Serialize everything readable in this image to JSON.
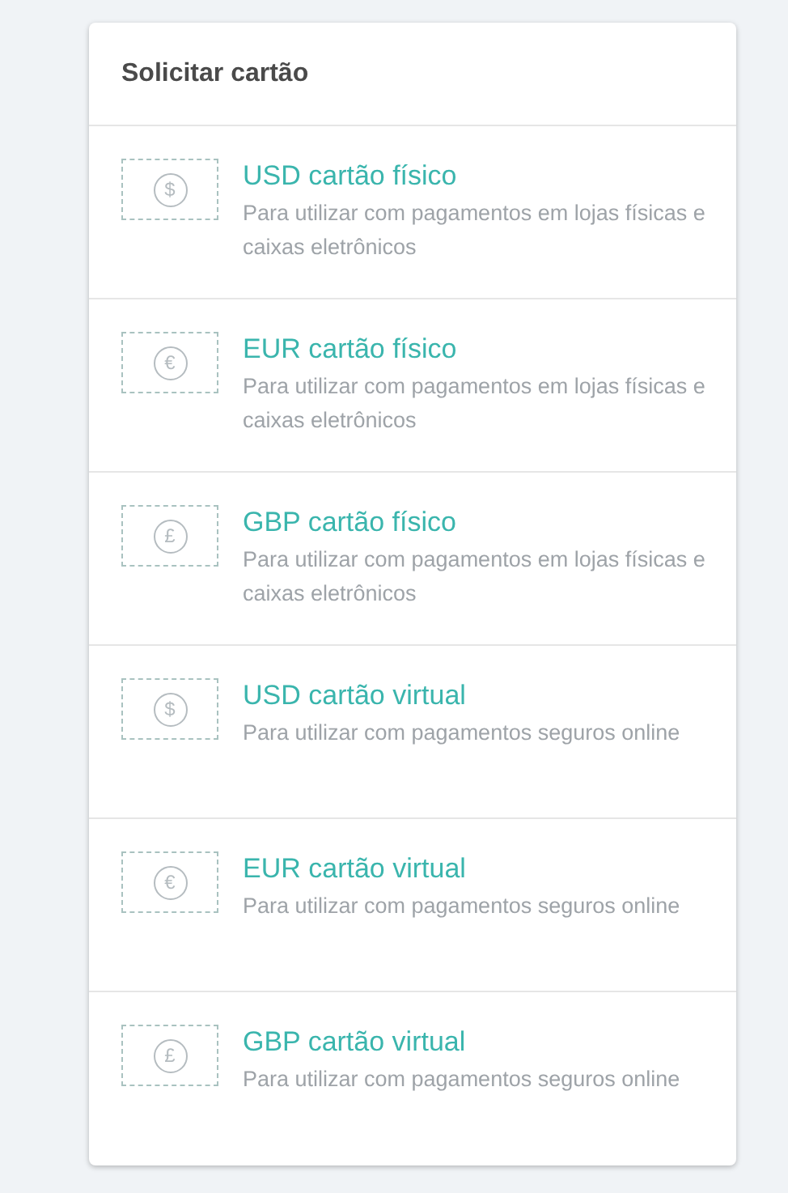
{
  "card": {
    "title": "Solicitar cartão",
    "items": [
      {
        "symbol": "$",
        "title": "USD cartão físico",
        "description": "Para utilizar com pagamentos em lojas físicas e caixas eletrônicos"
      },
      {
        "symbol": "€",
        "title": "EUR cartão físico",
        "description": "Para utilizar com pagamentos em lojas físicas e caixas eletrônicos"
      },
      {
        "symbol": "£",
        "title": "GBP cartão físico",
        "description": "Para utilizar com pagamentos em lojas físicas e caixas eletrônicos"
      },
      {
        "symbol": "$",
        "title": "USD cartão virtual",
        "description": "Para utilizar com pagamentos seguros online"
      },
      {
        "symbol": "€",
        "title": "EUR cartão virtual",
        "description": "Para utilizar com pagamentos seguros online"
      },
      {
        "symbol": "£",
        "title": "GBP cartão virtual",
        "description": "Para utilizar com pagamentos seguros online"
      }
    ]
  }
}
